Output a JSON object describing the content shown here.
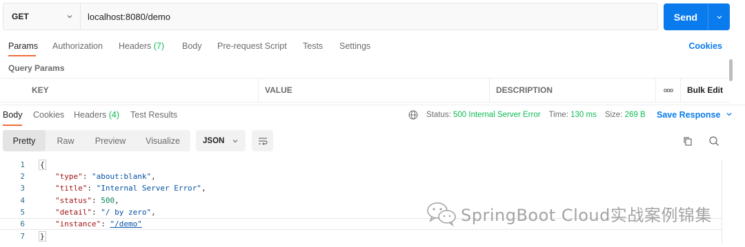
{
  "request": {
    "method": "GET",
    "url": "localhost:8080/demo",
    "send_label": "Send"
  },
  "request_tabs": [
    {
      "label": "Params",
      "active": true
    },
    {
      "label": "Authorization"
    },
    {
      "label": "Headers",
      "count": "(7)"
    },
    {
      "label": "Body"
    },
    {
      "label": "Pre-request Script"
    },
    {
      "label": "Tests"
    },
    {
      "label": "Settings"
    }
  ],
  "cookies_label": "Cookies",
  "query_params": {
    "title": "Query Params",
    "columns": [
      "KEY",
      "VALUE",
      "DESCRIPTION"
    ],
    "more_icon": "ooo",
    "bulk_edit": "Bulk Edit"
  },
  "response": {
    "tabs": [
      {
        "label": "Body",
        "active": true
      },
      {
        "label": "Cookies"
      },
      {
        "label": "Headers",
        "count": "(4)"
      },
      {
        "label": "Test Results"
      }
    ],
    "status_label": "Status:",
    "status_value": "500 Internal Server Error",
    "time_label": "Time:",
    "time_value": "130 ms",
    "size_label": "Size:",
    "size_value": "269 B",
    "save_response": "Save Response"
  },
  "view": {
    "modes": [
      "Pretty",
      "Raw",
      "Preview",
      "Visualize"
    ],
    "active_mode": "Pretty",
    "format": "JSON"
  },
  "body_lines": [
    {
      "n": "1",
      "open": "{"
    },
    {
      "n": "2",
      "key": "\"type\"",
      "value": "\"about:blank\"",
      "kind": "str",
      "comma": ","
    },
    {
      "n": "3",
      "key": "\"title\"",
      "value": "\"Internal Server Error\"",
      "kind": "str",
      "comma": ","
    },
    {
      "n": "4",
      "key": "\"status\"",
      "value": "500",
      "kind": "num",
      "comma": ","
    },
    {
      "n": "5",
      "key": "\"detail\"",
      "value": "\"/ by zero\"",
      "kind": "str",
      "comma": ","
    },
    {
      "n": "6",
      "key": "\"instance\"",
      "value": "\"/demo\"",
      "kind": "str",
      "comma": ""
    },
    {
      "n": "7",
      "close": "}"
    }
  ],
  "watermark": "SpringBoot Cloud实战案例锦集",
  "colors": {
    "accent": "#097bed",
    "tab_underline": "#f26b3a",
    "status_green": "#0cbb52"
  }
}
